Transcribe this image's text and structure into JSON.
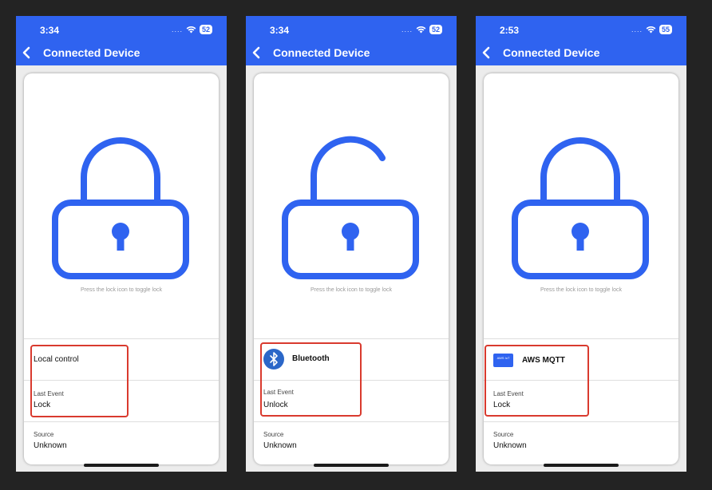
{
  "colors": {
    "accent": "#2f63f0",
    "highlight": "#d93a2e",
    "bluetooth": "#2b67c8"
  },
  "screens": [
    {
      "time": "3:34",
      "battery": "52",
      "title": "Connected Device",
      "lock_state": "locked",
      "lock_icon": "lock-closed-icon",
      "hint": "Press the lock icon to toggle lock",
      "control": {
        "icon": null,
        "label": "Local control"
      },
      "last_event": {
        "label": "Last Event",
        "value": "Lock"
      },
      "source": {
        "label": "Source",
        "value": "Unknown"
      }
    },
    {
      "time": "3:34",
      "battery": "52",
      "title": "Connected Device",
      "lock_state": "unlocked",
      "lock_icon": "lock-open-icon",
      "hint": "Press the lock icon to toggle lock",
      "control": {
        "icon": "bluetooth-icon",
        "label": "Bluetooth"
      },
      "last_event": {
        "label": "Last Event",
        "value": "Unlock"
      },
      "source": {
        "label": "Source",
        "value": "Unknown"
      }
    },
    {
      "time": "2:53",
      "battery": "55",
      "title": "Connected Device",
      "lock_state": "locked",
      "lock_icon": "lock-closed-icon",
      "hint": "Press the lock icon to toggle lock",
      "control": {
        "icon": "aws-iot-icon",
        "icon_text": "AWS IoT",
        "label": "AWS MQTT"
      },
      "last_event": {
        "label": "Last Event",
        "value": "Lock"
      },
      "source": {
        "label": "Source",
        "value": "Unknown"
      }
    }
  ]
}
